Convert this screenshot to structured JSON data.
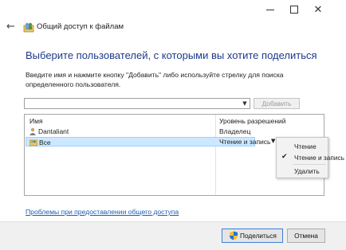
{
  "window": {
    "title_buttons": {
      "minimize": "minimize-icon",
      "maximize": "maximize-icon",
      "close": "close-icon"
    }
  },
  "header": {
    "title": "Общий доступ к файлам"
  },
  "instruction": "Выберите пользователей, с которыми вы хотите поделиться",
  "description": "Введите имя и нажмите кнопку \"Добавить\" либо используйте стрелку для поиска определенного пользователя.",
  "input": {
    "value": "",
    "placeholder": ""
  },
  "add_button": "Добавить",
  "table": {
    "columns": [
      "Имя",
      "Уровень разрешений"
    ],
    "rows": [
      {
        "name": "Dantaliant",
        "permission": "Владелец",
        "selected": false
      },
      {
        "name": "Все",
        "permission": "Чтение и запись",
        "selected": true
      }
    ]
  },
  "permission_menu": {
    "items": [
      {
        "label": "Чтение",
        "checked": false
      },
      {
        "label": "Чтение и запись",
        "checked": true
      },
      {
        "label": "Удалить",
        "checked": false
      }
    ]
  },
  "help_link": "Проблемы при предоставлении общего доступа",
  "footer": {
    "share_button": "Поделиться",
    "cancel_button": "Отмена"
  },
  "colors": {
    "instruction": "#1e3a8a",
    "link": "#1a5fb4",
    "selection": "#cce8ff",
    "primary_border": "#3c7fd6"
  }
}
